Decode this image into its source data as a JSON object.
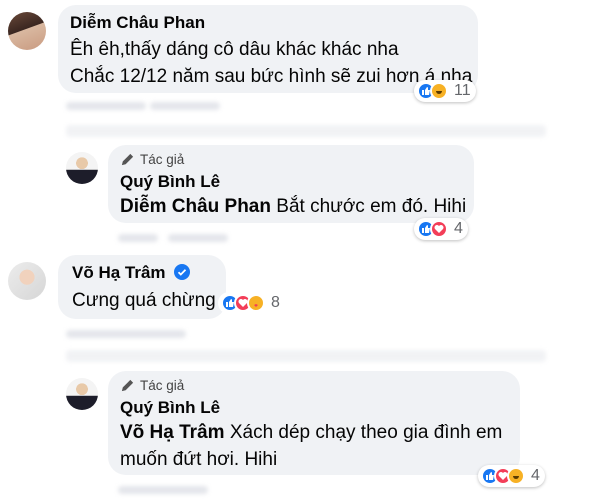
{
  "comments": [
    {
      "author": "Diễm Châu Phan",
      "lines": [
        "Êh êh,thấy dáng cô dâu khác khác nha",
        "Chắc 12/12 năm sau bức hình sẽ zui hơn á nha"
      ],
      "reaction_count": "11"
    },
    {
      "badge": "Tác giả",
      "author": "Quý Bình Lê",
      "mention": "Diễm Châu Phan",
      "text": "Bắt chước em đó. Hihi",
      "reaction_count": "4"
    },
    {
      "author": "Võ Hạ Trâm",
      "verified": true,
      "text": "Cưng quá chừng",
      "reaction_count": "8"
    },
    {
      "badge": "Tác giả",
      "author": "Quý Bình Lê",
      "mention": "Võ Hạ Trâm",
      "lines": [
        "Xách dép chạy theo gia đình em",
        "muốn đứt hơi. Hihi"
      ],
      "reaction_count": "4"
    }
  ],
  "colors": {
    "bubble": "#f0f2f5",
    "like": "#1877f2",
    "love": "#f33e58",
    "haha": "#f7b125",
    "verified": "#1877f2"
  }
}
